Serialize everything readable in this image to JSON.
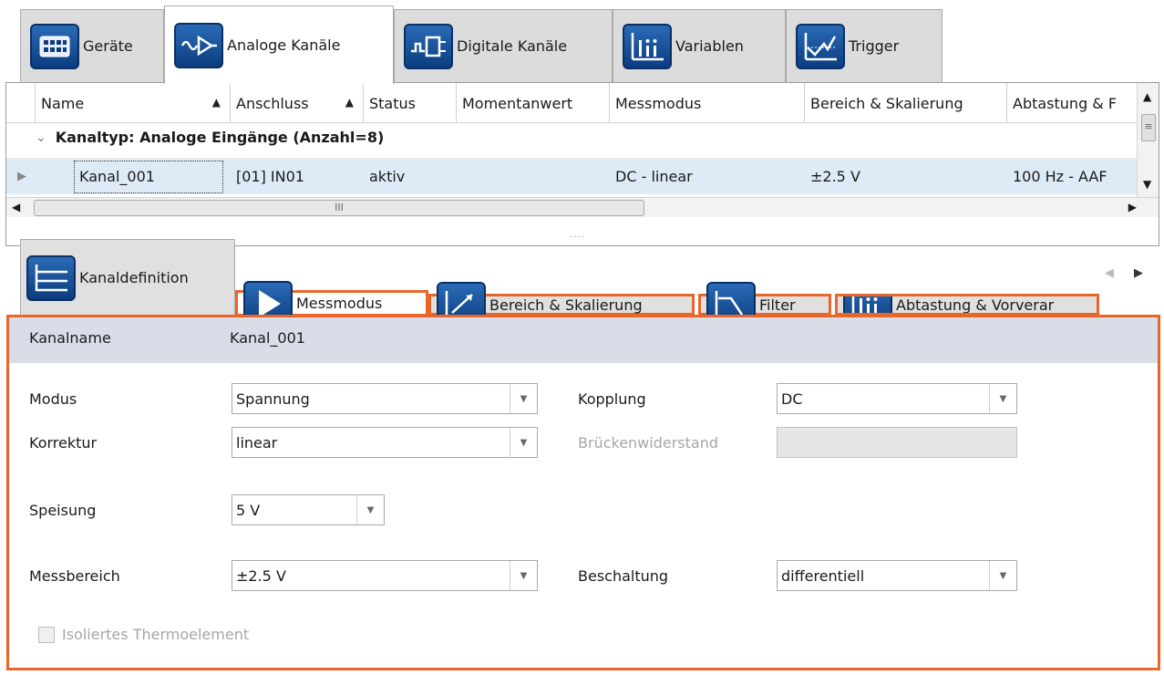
{
  "top_tabs": [
    {
      "label": "Geräte",
      "icon": "devices-icon"
    },
    {
      "label": "Analoge Kanäle",
      "icon": "analog-channels-icon"
    },
    {
      "label": "Digitale Kanäle",
      "icon": "digital-channels-icon"
    },
    {
      "label": "Variablen",
      "icon": "variables-icon"
    },
    {
      "label": "Trigger",
      "icon": "trigger-icon"
    }
  ],
  "active_top_tab": "Analoge Kanäle",
  "table": {
    "columns": [
      "Name",
      "Anschluss",
      "Status",
      "Momentanwert",
      "Messmodus",
      "Bereich & Skalierung",
      "Abtastung & F"
    ],
    "group_label": "Kanaltyp: Analoge Eingänge (Anzahl=8)",
    "rows": [
      {
        "name": "Kanal_001",
        "anschluss": "[01] IN01",
        "status": "aktiv",
        "momentanwert": "",
        "messmodus": "DC - linear",
        "bereich": "±2.5 V",
        "abtastung": "100 Hz - AAF"
      }
    ],
    "hscroll_grip": "III",
    "splitter": "....",
    "scroll_up": "▲",
    "scroll_down": "▼",
    "scroll_left": "◀",
    "scroll_right": "▶",
    "row_marker": "▶",
    "sort_arrow": "▲",
    "group_chevron": "⌄",
    "vscroll_grip": "≡"
  },
  "sub_tabs": [
    {
      "label": "Kanaldefinition",
      "icon": "channel-definition-icon"
    },
    {
      "label": "Messmodus",
      "icon": "play-icon"
    },
    {
      "label": "Bereich & Skalierung",
      "icon": "range-scaling-icon"
    },
    {
      "label": "Filter",
      "icon": "filter-icon"
    },
    {
      "label": "Abtastung & Vorverar",
      "icon": "sampling-icon"
    }
  ],
  "sub_nav": {
    "left": "◀",
    "right": "▶"
  },
  "active_sub_tab": "Messmodus",
  "highlight_color": "#e8662a",
  "panel": {
    "kanalname_label": "Kanalname",
    "kanalname_value": "Kanal_001",
    "modus_label": "Modus",
    "modus_value": "Spannung",
    "korrektur_label": "Korrektur",
    "korrektur_value": "linear",
    "kopplung_label": "Kopplung",
    "kopplung_value": "DC",
    "brueckenwiderstand_label": "Brückenwiderstand",
    "brueckenwiderstand_value": "",
    "speisung_label": "Speisung",
    "speisung_value": "5 V",
    "messbereich_label": "Messbereich",
    "messbereich_value": "±2.5 V",
    "beschaltung_label": "Beschaltung",
    "beschaltung_value": "differentiell",
    "isoliert_label": "Isoliertes Thermoelement",
    "dropdown_glyph": "▼"
  }
}
